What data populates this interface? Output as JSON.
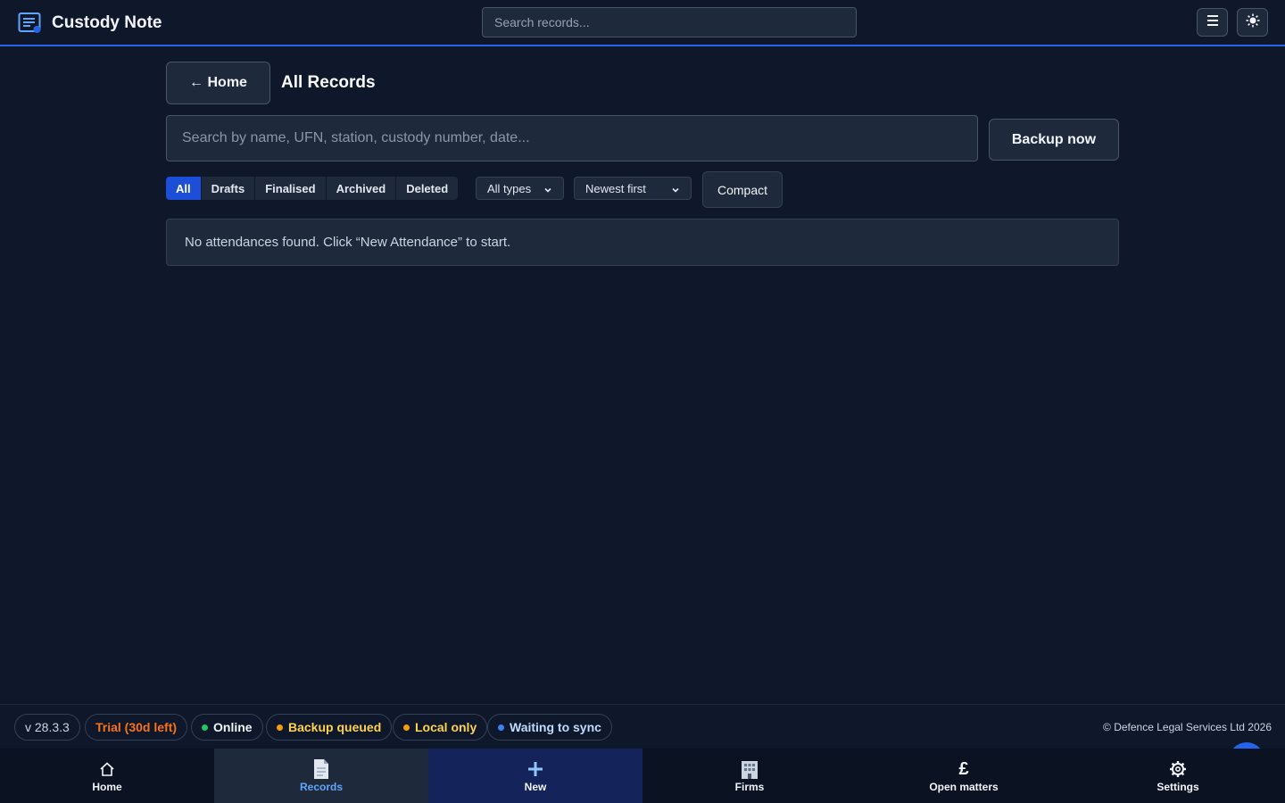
{
  "app": {
    "title": "Custody Note",
    "search_placeholder": "Search records...",
    "menu_icon": "hamburger-menu-icon",
    "theme_icon": "sun-icon",
    "accent_color": "#2563eb"
  },
  "page": {
    "home_label": "← Home",
    "title": "All Records",
    "search_placeholder": "Search by name, UFN, station, custody number, date...",
    "backup_label": "Backup now",
    "filters": [
      {
        "label": "All",
        "active": true
      },
      {
        "label": "Drafts",
        "active": false
      },
      {
        "label": "Finalised",
        "active": false
      },
      {
        "label": "Archived",
        "active": false
      },
      {
        "label": "Deleted",
        "active": false
      }
    ],
    "type_select": "All types",
    "sort_select": "Newest first",
    "compact_label": "Compact",
    "empty_message": "No attendances found. Click “New Attendance” to start."
  },
  "status": {
    "version": "v 28.3.3",
    "trial": "Trial (30d left)",
    "trial_color": "#f97316",
    "online": {
      "label": "Online",
      "color": "#22c55e"
    },
    "backup": {
      "label": "Backup queued",
      "color": "#f59e0b"
    },
    "local": {
      "label": "Local only",
      "color": "#f59e0b"
    },
    "sync": {
      "label": "Waiting to sync",
      "color": "#3b82f6"
    },
    "copyright": "© Defence Legal Services Ltd 2026"
  },
  "nav": [
    {
      "label": "Home",
      "icon": "home-icon"
    },
    {
      "label": "Records",
      "icon": "document-icon"
    },
    {
      "label": "New",
      "icon": "plus-icon"
    },
    {
      "label": "Firms",
      "icon": "building-icon"
    },
    {
      "label": "Open matters",
      "icon": "pound-icon"
    },
    {
      "label": "Settings",
      "icon": "gear-icon"
    }
  ]
}
